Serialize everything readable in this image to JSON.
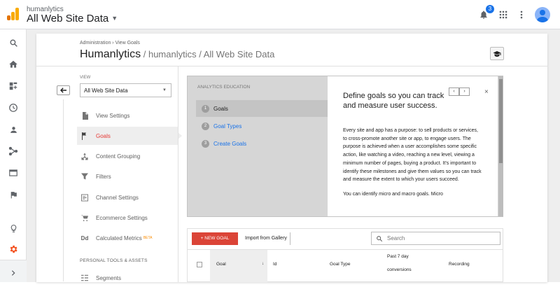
{
  "header": {
    "account_name": "humanlytics",
    "property_view": "All Web Site Data",
    "notification_count": "3",
    "icons": [
      "analytics-logo",
      "bell-icon",
      "apps-grid-icon",
      "more-vert-icon",
      "avatar"
    ]
  },
  "left_rail": {
    "icons": [
      "search-icon",
      "home-icon",
      "customization-icon",
      "realtime-clock-icon",
      "audience-person-icon",
      "acquisition-icon",
      "behavior-icon",
      "conversions-flag-icon",
      "discover-bulb-icon",
      "admin-gear-icon",
      "expand-chevron-icon"
    ]
  },
  "page": {
    "breadcrumb": "Administration › View Goals",
    "title": "Humanlytics",
    "title_path": " / humanlytics / All Web Site Data"
  },
  "view": {
    "label": "VIEW",
    "selected": "All Web Site Data"
  },
  "nav": {
    "items": [
      {
        "label": "View Settings",
        "icon": "document-icon"
      },
      {
        "label": "Goals",
        "icon": "flag-icon"
      },
      {
        "label": "Content Grouping",
        "icon": "grouping-icon"
      },
      {
        "label": "Filters",
        "icon": "filter-icon"
      },
      {
        "label": "Channel Settings",
        "icon": "channel-icon"
      },
      {
        "label": "Ecommerce Settings",
        "icon": "cart-icon"
      },
      {
        "label": "Calculated Metrics",
        "icon": "dd-icon",
        "badge": "BETA"
      },
      {
        "label": "Segments",
        "icon": "segments-icon"
      }
    ],
    "section_label": "PERSONAL TOOLS & ASSETS",
    "active": "Goals"
  },
  "education": {
    "heading": "ANALYTICS EDUCATION",
    "steps": [
      {
        "num": "1",
        "label": "Goals"
      },
      {
        "num": "2",
        "label": "Goal Types"
      },
      {
        "num": "3",
        "label": "Create Goals"
      }
    ],
    "panel_title": "Define goals so you can track and measure user success.",
    "paragraph_1": "Every site and app has a purpose: to sell products or services, to cross-promote another site or app, to engage users. The purpose is achieved when a user accomplishes some specific action, like watching a video, reaching a new level, viewing a minimum number of pages, buying a product. It’s important to identify these milestones and give them values so you can track and measure the extent to which your users succeed.",
    "paragraph_2": "You can identify micro and macro goals. Micro",
    "pager_prev": "‹",
    "pager_next": "›",
    "close": "×"
  },
  "table": {
    "new_goal": "+ NEW GOAL",
    "import": "Import from Gallery",
    "search_placeholder": "Search",
    "columns": {
      "goal": "Goal",
      "goal_sort": "↓",
      "id": "Id",
      "goal_type": "Goal Type",
      "past7_line1": "Past 7 day",
      "past7_line2": "conversions",
      "recording": "Recording"
    }
  },
  "colors": {
    "accent_red": "#db4437",
    "link_blue": "#1a73e8",
    "logo_orange": "#f9ab00",
    "logo_dark_orange": "#e37400"
  }
}
